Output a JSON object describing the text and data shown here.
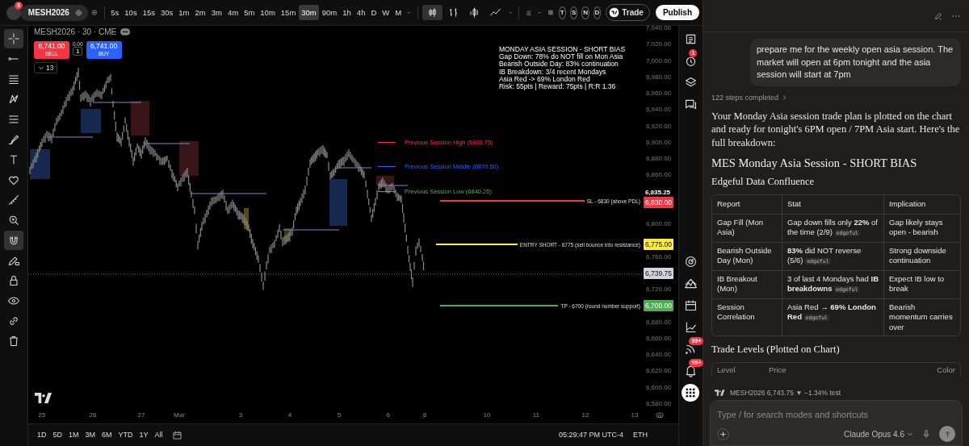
{
  "toolbar": {
    "avatar_badge": "3",
    "symbol": "MESH2026",
    "intervals": [
      {
        "label": "5s",
        "selected": false
      },
      {
        "label": "10s",
        "selected": false
      },
      {
        "label": "15s",
        "selected": false
      },
      {
        "label": "30s",
        "selected": false
      },
      {
        "label": "1m",
        "selected": false
      },
      {
        "label": "2m",
        "selected": false
      },
      {
        "label": "3m",
        "selected": false
      },
      {
        "label": "4m",
        "selected": false
      },
      {
        "label": "5m",
        "selected": false
      },
      {
        "label": "10m",
        "selected": false
      },
      {
        "label": "15m",
        "selected": false
      },
      {
        "label": "30m",
        "selected": true
      },
      {
        "label": "90m",
        "selected": false
      },
      {
        "label": "1h",
        "selected": false
      },
      {
        "label": "4h",
        "selected": false
      },
      {
        "label": "D",
        "selected": false
      },
      {
        "label": "W",
        "selected": false
      },
      {
        "label": "M",
        "selected": false
      }
    ],
    "chart_types": [
      {
        "kind": "candles",
        "selected": true
      },
      {
        "kind": "bars",
        "selected": false
      },
      {
        "kind": "hollow",
        "selected": false
      },
      {
        "kind": "line",
        "selected": false
      }
    ],
    "session_buttons": [
      "T",
      "S",
      "N",
      "D"
    ],
    "trade_label": "Trade",
    "publish_label": "Publish"
  },
  "left_tools": [
    {
      "kind": "crosshair",
      "selected": true
    },
    {
      "kind": "trend-line",
      "selected": false
    },
    {
      "kind": "horizontal-lines",
      "selected": false
    },
    {
      "kind": "pattern",
      "selected": false
    },
    {
      "kind": "fib",
      "selected": false
    },
    {
      "kind": "brush",
      "selected": false
    },
    {
      "kind": "text",
      "selected": false
    },
    {
      "kind": "heart",
      "selected": false
    },
    {
      "kind": "ruler",
      "selected": false
    },
    {
      "kind": "zoom",
      "selected": false
    },
    {
      "kind": "magnet",
      "selected": true
    },
    {
      "kind": "pencil-lock",
      "selected": false
    },
    {
      "kind": "lock",
      "selected": false
    },
    {
      "kind": "eye",
      "selected": false
    },
    {
      "kind": "link",
      "selected": false
    },
    {
      "kind": "trash",
      "selected": false
    }
  ],
  "chart": {
    "legend": "MESH2026 · 30 · CME",
    "sell": {
      "price": "6,741.00",
      "label": "SELL"
    },
    "spread": "0.00",
    "quantity": "1",
    "buy": {
      "price": "6,741.00",
      "label": "BUY"
    },
    "indicators_count": "13",
    "info_box": [
      "MONDAY ASIA SESSION - SHORT BIAS",
      "Gap Down: 78% do NOT fill on Mon Asia",
      "Bearish Outside Day: 83% continuation",
      "IB Breakdown: 3/4 recent Mondays",
      "Asia Red -> 69% London Red",
      "Risk: 55pts | Reward: 75pts | R:R 1.36"
    ],
    "levels": [
      {
        "kind": "session",
        "label": "Previous Session High (6900.75)",
        "color": "#f23645"
      },
      {
        "kind": "session",
        "label": "Previous Session Middle (6870.50)",
        "color": "#2962ff"
      },
      {
        "kind": "session",
        "label": "Previous Session Low (6840.25)",
        "color": "#4caf50"
      },
      {
        "kind": "trade",
        "label": "SL - 6830 (above PDL)",
        "color": "#f23645"
      },
      {
        "kind": "trade",
        "label": "ENTRY SHORT - 6775 (sell bounce into resistance)",
        "color": "#ffeb3b"
      },
      {
        "kind": "trade",
        "label": "TP - 6700 (round number support)",
        "color": "#4caf50"
      }
    ],
    "price_axis": [
      {
        "kind": "tick",
        "label": "7,040.00"
      },
      {
        "kind": "tick",
        "label": "7,020.00"
      },
      {
        "kind": "tick",
        "label": "7,000.00"
      },
      {
        "kind": "tick",
        "label": "6,980.00"
      },
      {
        "kind": "tick",
        "label": "6,960.00"
      },
      {
        "kind": "tick",
        "label": "6,940.00"
      },
      {
        "kind": "tick",
        "label": "6,920.00"
      },
      {
        "kind": "tick",
        "label": "6,900.00"
      },
      {
        "kind": "tick",
        "label": "6,880.00"
      },
      {
        "kind": "tick",
        "label": "6,860.00"
      },
      {
        "kind": "marker",
        "label": "6,835.25"
      },
      {
        "kind": "tag",
        "label": "6,830.00",
        "color": "#f23645"
      },
      {
        "kind": "tick",
        "label": "6,800.00"
      },
      {
        "kind": "tag",
        "label": "6,775.00",
        "color": "#ffeb3b"
      },
      {
        "kind": "tick",
        "label": "6,760.00"
      },
      {
        "kind": "tag",
        "label": "6,739.75",
        "color": "#d1d4dc"
      },
      {
        "kind": "tick",
        "label": "6,720.00"
      },
      {
        "kind": "tag",
        "label": "6,700.00",
        "color": "#4caf50"
      },
      {
        "kind": "tick",
        "label": "6,680.00"
      },
      {
        "kind": "tick",
        "label": "6,660.00"
      },
      {
        "kind": "tick",
        "label": "6,640.00"
      },
      {
        "kind": "tick",
        "label": "6,620.00"
      },
      {
        "kind": "tick",
        "label": "6,600.00"
      },
      {
        "kind": "tick",
        "label": "6,580.00"
      }
    ],
    "time_axis": [
      "25",
      "26",
      "27",
      "Mar",
      "3",
      "4",
      "5",
      "6",
      "8",
      "10",
      "11",
      "12",
      "13"
    ]
  },
  "bottom_bar": {
    "ranges": [
      "1D",
      "5D",
      "1M",
      "3M",
      "6M",
      "YTD",
      "1Y",
      "All"
    ],
    "clock": "05:29:47 PM UTC-4",
    "session": "ETH"
  },
  "right_rail": [
    {
      "kind": "watchlist"
    },
    {
      "kind": "alarm",
      "badge": "1"
    },
    {
      "kind": "layers"
    },
    {
      "kind": "chat"
    },
    {
      "kind": "target"
    },
    {
      "kind": "mountains"
    },
    {
      "kind": "calendar"
    },
    {
      "kind": "chart-line"
    },
    {
      "kind": "feed",
      "badge": "99+"
    },
    {
      "kind": "bell",
      "badge": "99+"
    },
    {
      "kind": "apps"
    }
  ],
  "assistant": {
    "user_message": "prepare me for the weekly open asia session. The market will open at 6pm tonight and the asia session will start at 7pm",
    "steps": "122 steps completed",
    "intro": "Your Monday Asia session trade plan is plotted on the chart and ready for tonight's 6PM open / 7PM Asia start. Here's the full breakdown:",
    "heading": "MES Monday Asia Session - SHORT BIAS",
    "subheading": "Edgeful Data Confluence",
    "table": {
      "columns": [
        "Report",
        "Stat",
        "Implication"
      ],
      "rows": [
        {
          "report": "Gap Fill (Mon Asia)",
          "stat": "Gap down fills only **22%** of the time (2/9)",
          "source": "edgeful",
          "implication": "Gap likely stays open - bearish"
        },
        {
          "report": "Bearish Outside Day (Mon)",
          "stat": "**83%** did NOT reverse (5/6)",
          "source": "edgeful",
          "implication": "Strong downside continuation"
        },
        {
          "report": "IB Breakout (Mon)",
          "stat": "3 of last 4 Mondays had **IB breakdowns**",
          "source": "edgeful",
          "implication": "Expect IB low to break"
        },
        {
          "report": "Session Correlation",
          "stat": "Asia Red → **69% London Red**",
          "source": "edgeful",
          "implication": "Bearish momentum carries over"
        }
      ]
    },
    "levels_heading": "Trade Levels (Plotted on Chart)",
    "levels_columns": [
      "Level",
      "Price",
      "Color"
    ],
    "ticker": "MESH2026 6,743.75 ▼ −1.34% test",
    "input": {
      "placeholder": "Type / for search modes and shortcuts"
    },
    "model": "Claude Opus 4.6"
  }
}
